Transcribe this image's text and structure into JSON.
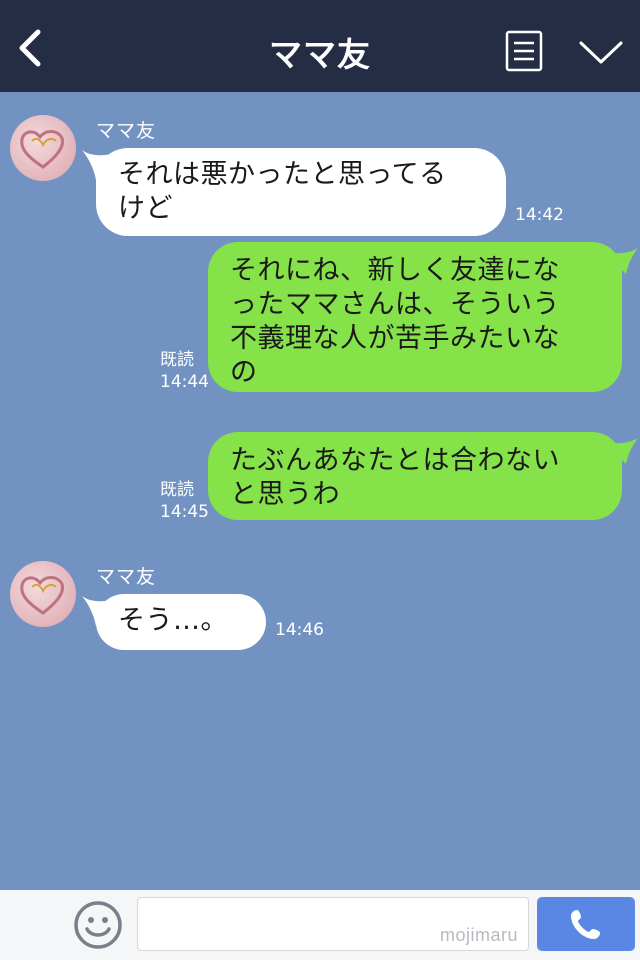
{
  "header": {
    "title": "ママ友",
    "back_icon": "chevron-left-icon",
    "menu_icon": "list-icon",
    "more_icon": "chevron-down-icon"
  },
  "messages": [
    {
      "side": "left",
      "sender": "ママ友",
      "lines": [
        "それは悪かったと思ってる",
        "けど"
      ],
      "time": "14:42"
    },
    {
      "side": "right",
      "read": "既読",
      "lines": [
        "それにね、新しく友達にな",
        "ったママさんは、そういう",
        "不義理な人が苦手みたいな",
        "の"
      ],
      "time": "14:44"
    },
    {
      "side": "right",
      "read": "既読",
      "lines": [
        "たぶんあなたとは合わない",
        "と思うわ"
      ],
      "time": "14:45"
    },
    {
      "side": "left",
      "sender": "ママ友",
      "lines": [
        "そう…。"
      ],
      "time": "14:46"
    }
  ],
  "footer": {
    "plus_icon": "plus-icon",
    "emoji_icon": "smiley-icon",
    "input_value": "",
    "watermark": "mojimaru",
    "call_icon": "phone-icon"
  },
  "colors": {
    "header_bg": "#242d43",
    "chat_bg": "#7293c2",
    "my_bubble": "#85e249",
    "their_bubble": "#ffffff",
    "call_button": "#5b87e4"
  }
}
